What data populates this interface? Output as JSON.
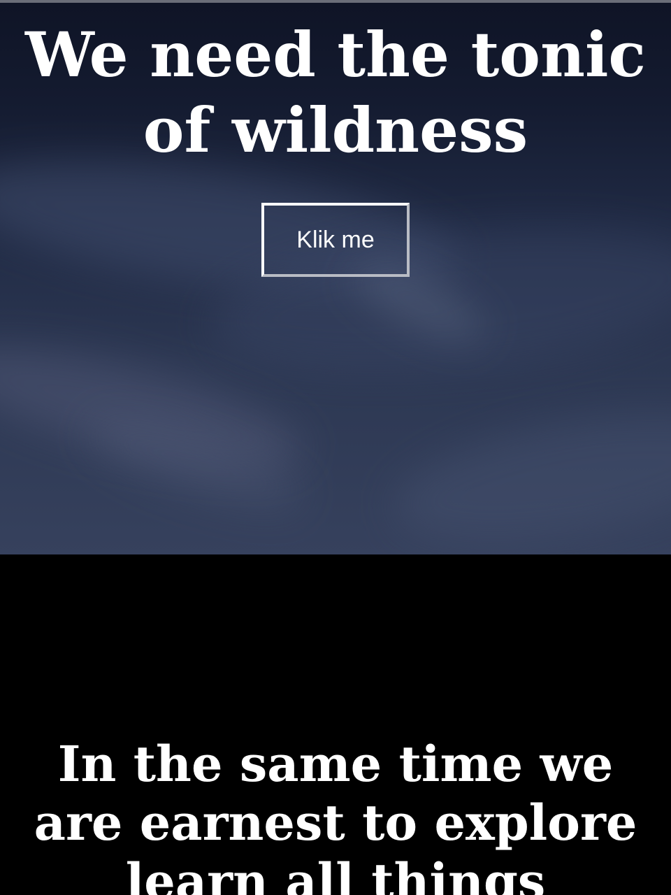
{
  "hero": {
    "title": "We need the tonic of wildness",
    "button_label": "Klik me"
  },
  "section": {
    "heading": "In the same time we are earnest to explore learn all things"
  },
  "colors": {
    "hero_sky_top": "#0f1426",
    "hero_sky_bottom": "#36415d",
    "section_background": "#000000",
    "text": "#ffffff"
  }
}
